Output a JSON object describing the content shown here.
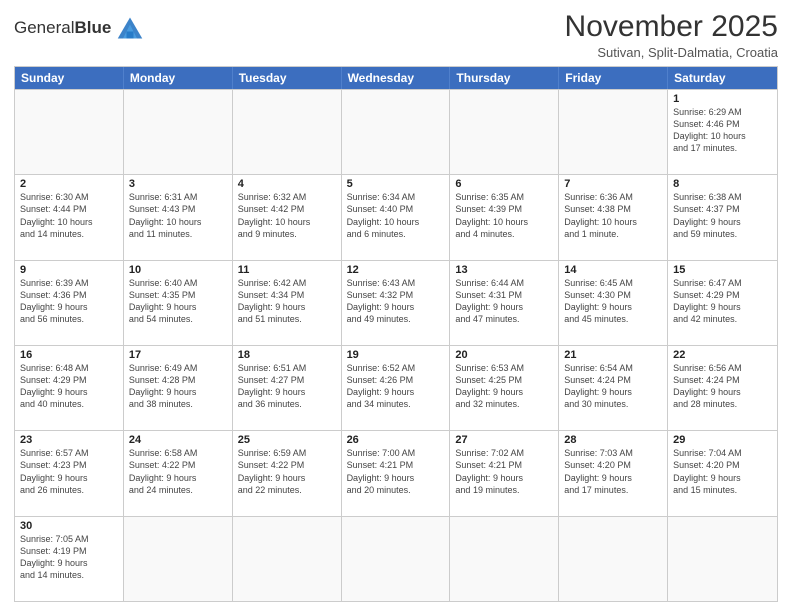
{
  "logo": {
    "text_light": "General",
    "text_bold": "Blue"
  },
  "header": {
    "month": "November 2025",
    "location": "Sutivan, Split-Dalmatia, Croatia"
  },
  "weekdays": [
    "Sunday",
    "Monday",
    "Tuesday",
    "Wednesday",
    "Thursday",
    "Friday",
    "Saturday"
  ],
  "weeks": [
    [
      {
        "day": "",
        "info": ""
      },
      {
        "day": "",
        "info": ""
      },
      {
        "day": "",
        "info": ""
      },
      {
        "day": "",
        "info": ""
      },
      {
        "day": "",
        "info": ""
      },
      {
        "day": "",
        "info": ""
      },
      {
        "day": "1",
        "info": "Sunrise: 6:29 AM\nSunset: 4:46 PM\nDaylight: 10 hours\nand 17 minutes."
      }
    ],
    [
      {
        "day": "2",
        "info": "Sunrise: 6:30 AM\nSunset: 4:44 PM\nDaylight: 10 hours\nand 14 minutes."
      },
      {
        "day": "3",
        "info": "Sunrise: 6:31 AM\nSunset: 4:43 PM\nDaylight: 10 hours\nand 11 minutes."
      },
      {
        "day": "4",
        "info": "Sunrise: 6:32 AM\nSunset: 4:42 PM\nDaylight: 10 hours\nand 9 minutes."
      },
      {
        "day": "5",
        "info": "Sunrise: 6:34 AM\nSunset: 4:40 PM\nDaylight: 10 hours\nand 6 minutes."
      },
      {
        "day": "6",
        "info": "Sunrise: 6:35 AM\nSunset: 4:39 PM\nDaylight: 10 hours\nand 4 minutes."
      },
      {
        "day": "7",
        "info": "Sunrise: 6:36 AM\nSunset: 4:38 PM\nDaylight: 10 hours\nand 1 minute."
      },
      {
        "day": "8",
        "info": "Sunrise: 6:38 AM\nSunset: 4:37 PM\nDaylight: 9 hours\nand 59 minutes."
      }
    ],
    [
      {
        "day": "9",
        "info": "Sunrise: 6:39 AM\nSunset: 4:36 PM\nDaylight: 9 hours\nand 56 minutes."
      },
      {
        "day": "10",
        "info": "Sunrise: 6:40 AM\nSunset: 4:35 PM\nDaylight: 9 hours\nand 54 minutes."
      },
      {
        "day": "11",
        "info": "Sunrise: 6:42 AM\nSunset: 4:34 PM\nDaylight: 9 hours\nand 51 minutes."
      },
      {
        "day": "12",
        "info": "Sunrise: 6:43 AM\nSunset: 4:32 PM\nDaylight: 9 hours\nand 49 minutes."
      },
      {
        "day": "13",
        "info": "Sunrise: 6:44 AM\nSunset: 4:31 PM\nDaylight: 9 hours\nand 47 minutes."
      },
      {
        "day": "14",
        "info": "Sunrise: 6:45 AM\nSunset: 4:30 PM\nDaylight: 9 hours\nand 45 minutes."
      },
      {
        "day": "15",
        "info": "Sunrise: 6:47 AM\nSunset: 4:29 PM\nDaylight: 9 hours\nand 42 minutes."
      }
    ],
    [
      {
        "day": "16",
        "info": "Sunrise: 6:48 AM\nSunset: 4:29 PM\nDaylight: 9 hours\nand 40 minutes."
      },
      {
        "day": "17",
        "info": "Sunrise: 6:49 AM\nSunset: 4:28 PM\nDaylight: 9 hours\nand 38 minutes."
      },
      {
        "day": "18",
        "info": "Sunrise: 6:51 AM\nSunset: 4:27 PM\nDaylight: 9 hours\nand 36 minutes."
      },
      {
        "day": "19",
        "info": "Sunrise: 6:52 AM\nSunset: 4:26 PM\nDaylight: 9 hours\nand 34 minutes."
      },
      {
        "day": "20",
        "info": "Sunrise: 6:53 AM\nSunset: 4:25 PM\nDaylight: 9 hours\nand 32 minutes."
      },
      {
        "day": "21",
        "info": "Sunrise: 6:54 AM\nSunset: 4:24 PM\nDaylight: 9 hours\nand 30 minutes."
      },
      {
        "day": "22",
        "info": "Sunrise: 6:56 AM\nSunset: 4:24 PM\nDaylight: 9 hours\nand 28 minutes."
      }
    ],
    [
      {
        "day": "23",
        "info": "Sunrise: 6:57 AM\nSunset: 4:23 PM\nDaylight: 9 hours\nand 26 minutes."
      },
      {
        "day": "24",
        "info": "Sunrise: 6:58 AM\nSunset: 4:22 PM\nDaylight: 9 hours\nand 24 minutes."
      },
      {
        "day": "25",
        "info": "Sunrise: 6:59 AM\nSunset: 4:22 PM\nDaylight: 9 hours\nand 22 minutes."
      },
      {
        "day": "26",
        "info": "Sunrise: 7:00 AM\nSunset: 4:21 PM\nDaylight: 9 hours\nand 20 minutes."
      },
      {
        "day": "27",
        "info": "Sunrise: 7:02 AM\nSunset: 4:21 PM\nDaylight: 9 hours\nand 19 minutes."
      },
      {
        "day": "28",
        "info": "Sunrise: 7:03 AM\nSunset: 4:20 PM\nDaylight: 9 hours\nand 17 minutes."
      },
      {
        "day": "29",
        "info": "Sunrise: 7:04 AM\nSunset: 4:20 PM\nDaylight: 9 hours\nand 15 minutes."
      }
    ],
    [
      {
        "day": "30",
        "info": "Sunrise: 7:05 AM\nSunset: 4:19 PM\nDaylight: 9 hours\nand 14 minutes."
      },
      {
        "day": "",
        "info": ""
      },
      {
        "day": "",
        "info": ""
      },
      {
        "day": "",
        "info": ""
      },
      {
        "day": "",
        "info": ""
      },
      {
        "day": "",
        "info": ""
      },
      {
        "day": "",
        "info": ""
      }
    ]
  ]
}
